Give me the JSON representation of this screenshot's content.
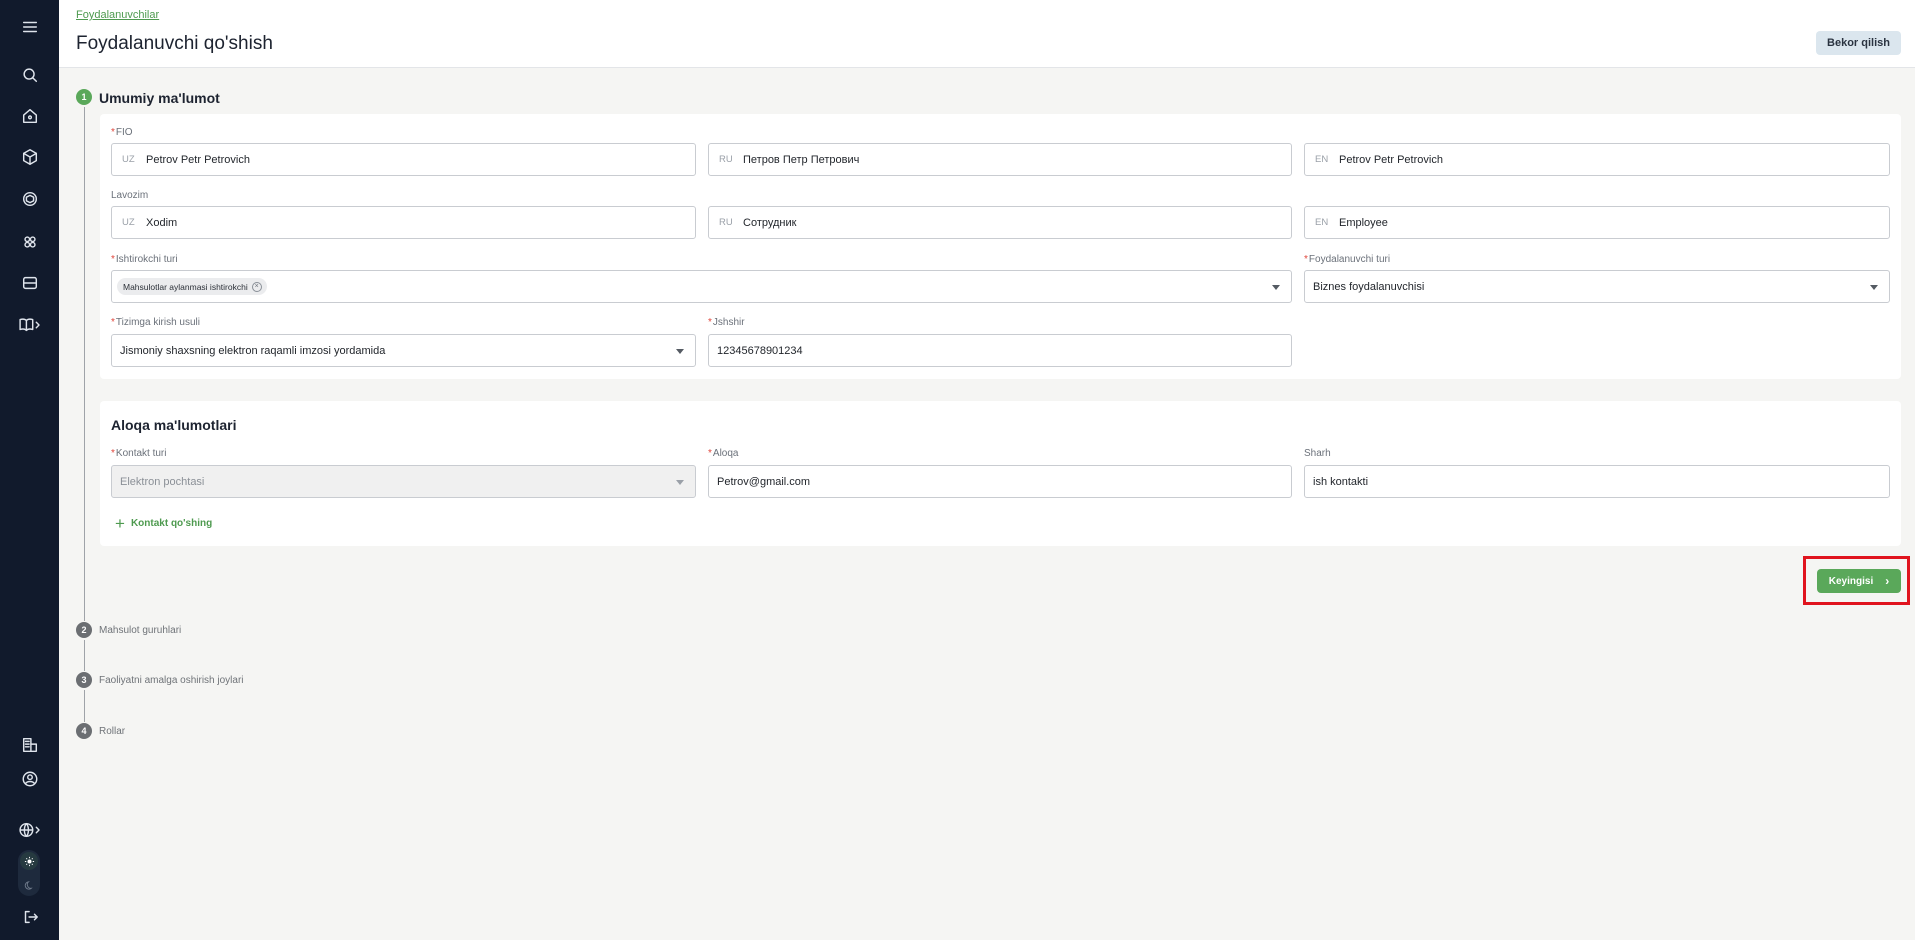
{
  "header": {
    "breadcrumb": "Foydalanuvchilar",
    "title": "Foydalanuvchi qo'shish",
    "cancel_label": "Bekor qilish"
  },
  "steps": [
    {
      "number": "1",
      "label": "Umumiy ma'lumot",
      "active": true
    },
    {
      "number": "2",
      "label": "Mahsulot guruhlari",
      "active": false
    },
    {
      "number": "3",
      "label": "Faoliyatni amalga oshirish joylari",
      "active": false
    },
    {
      "number": "4",
      "label": "Rollar",
      "active": false
    }
  ],
  "general": {
    "fio": {
      "label": "FIO",
      "uz": {
        "prefix": "UZ",
        "value": "Petrov Petr Petrovich"
      },
      "ru": {
        "prefix": "RU",
        "value": "Петров Петр Петрович"
      },
      "en": {
        "prefix": "EN",
        "value": "Petrov Petr Petrovich"
      }
    },
    "position": {
      "label": "Lavozim",
      "uz": {
        "prefix": "UZ",
        "value": "Xodim"
      },
      "ru": {
        "prefix": "RU",
        "value": "Сотрудник"
      },
      "en": {
        "prefix": "EN",
        "value": "Employee"
      }
    },
    "participant_type": {
      "label": "Ishtirokchi turi",
      "tag": "Mahsulotlar aylanmasi ishtirokchi"
    },
    "user_type": {
      "label": "Foydalanuvchi turi",
      "value": "Biznes foydalanuvchisi"
    },
    "login_method": {
      "label": "Tizimga kirish usuli",
      "value": "Jismoniy shaxsning elektron raqamli imzosi yordamida"
    },
    "jshshir": {
      "label": "Jshshir",
      "value": "12345678901234"
    }
  },
  "contacts": {
    "title": "Aloqa ma'lumotlari",
    "contact_type": {
      "label": "Kontakt turi",
      "value": "Elektron pochtasi"
    },
    "contact": {
      "label": "Aloqa",
      "value": "Petrov@gmail.com"
    },
    "comment": {
      "label": "Sharh",
      "value": "ish kontakti"
    },
    "add_label": "Kontakt qo'shing"
  },
  "next_label": "Keyingisi",
  "colors": {
    "accent": "#5aa85a",
    "sidebar": "#111a2c",
    "highlight": "#e0141e"
  },
  "sidebar_icons": [
    "menu-icon",
    "search-icon",
    "home-icon",
    "box-icon",
    "package-icon",
    "scan-icon",
    "storage-icon",
    "book-icon",
    "building-icon",
    "user-circle-icon",
    "globe-icon",
    "sun-icon",
    "moon-icon",
    "logout-icon"
  ]
}
